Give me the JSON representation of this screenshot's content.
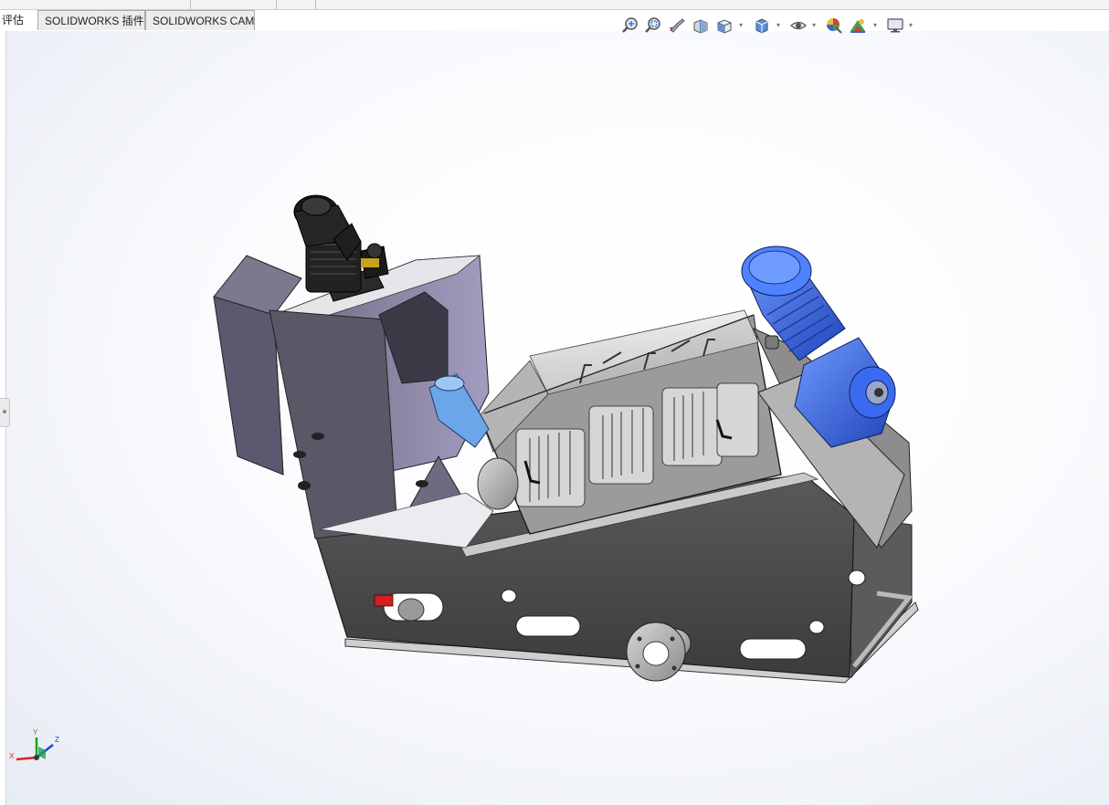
{
  "tabs": [
    {
      "label": "评估"
    },
    {
      "label": "SOLIDWORKS 插件"
    },
    {
      "label": "SOLIDWORKS CAM"
    }
  ],
  "heads_up_toolbar": {
    "icons": [
      "zoom-to-fit-icon",
      "zoom-to-area-icon",
      "previous-view-icon",
      "section-view-icon",
      "view-orientation-icon",
      "display-style-icon",
      "hide-show-items-icon",
      "edit-appearance-icon",
      "apply-scene-icon",
      "view-settings-icon"
    ]
  },
  "triad": {
    "x_label": "X",
    "y_label": "Y",
    "z_label": "Z"
  },
  "colors": {
    "motor_blue": "#2f5fd9",
    "frame_dark": "#4a4848",
    "panel_lavender": "#8e86a6",
    "motor_black": "#1e1e1e",
    "triad_x": "#e02020",
    "triad_y": "#20a020",
    "triad_z": "#2040e0"
  }
}
